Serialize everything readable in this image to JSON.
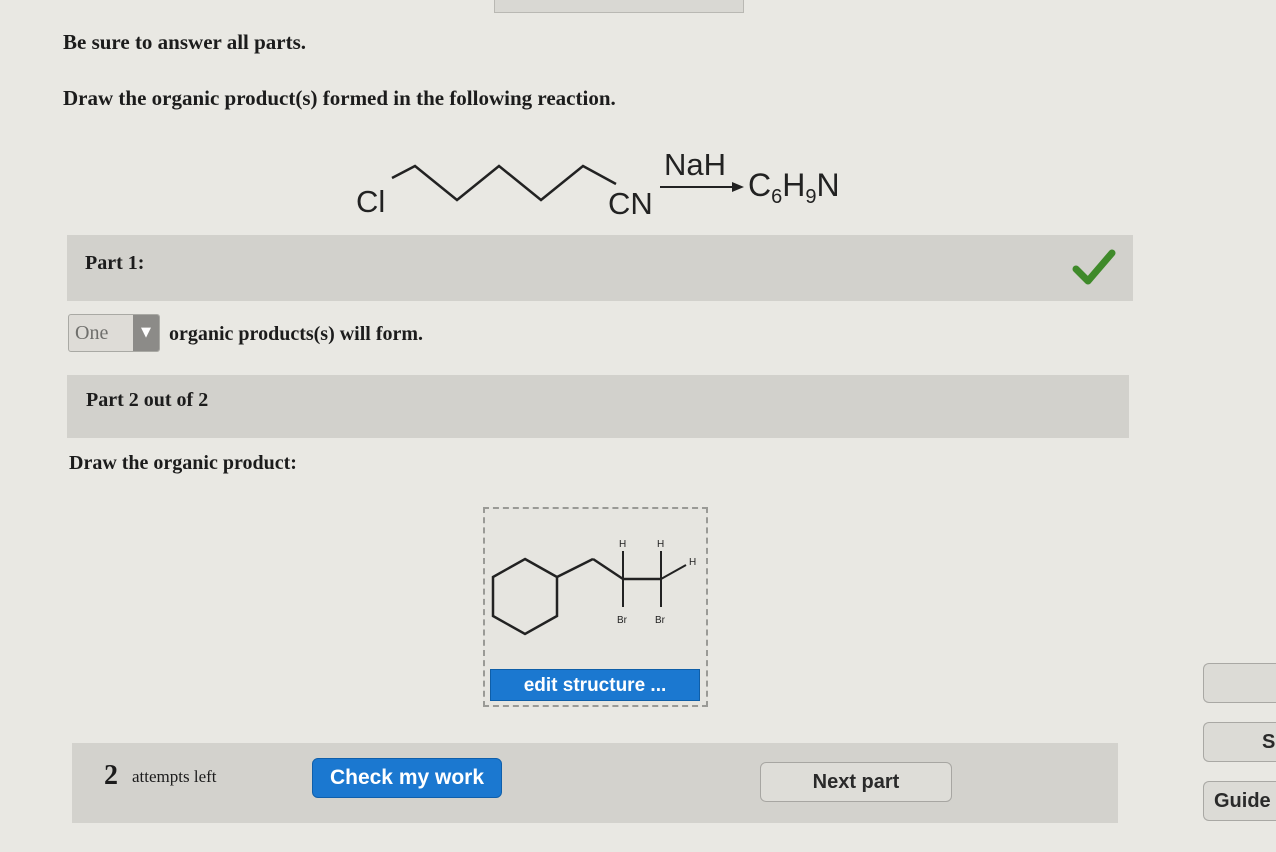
{
  "instructions": {
    "line1": "Be sure to answer all parts.",
    "line2": "Draw the organic product(s) formed in the following reaction."
  },
  "reaction": {
    "reactant_left_atom": "Cl",
    "reactant_right_group": "CN",
    "reagent": "NaH",
    "product_formula": {
      "c": "C",
      "c_sub": "6",
      "h": "H",
      "h_sub": "9",
      "n": "N"
    }
  },
  "part1": {
    "label": "Part 1:",
    "status": "correct",
    "dropdown_value": "One",
    "sentence": "organic products(s) will form."
  },
  "part2": {
    "label": "Part 2 out of 2",
    "prompt": "Draw the organic product:",
    "structure_labels": {
      "h1": "H",
      "h2": "H",
      "h3": "H",
      "br1": "Br",
      "br2": "Br"
    },
    "edit_button": "edit structure ..."
  },
  "footer": {
    "attempts_count": "2",
    "attempts_label": "attempts left",
    "check_button": "Check my work",
    "next_button": "Next part"
  },
  "sidebar": {
    "button2_label": "S",
    "button3_label": "Guide"
  },
  "colors": {
    "primary_button": "#1b78d0",
    "checkmark": "#3f8a2a"
  }
}
